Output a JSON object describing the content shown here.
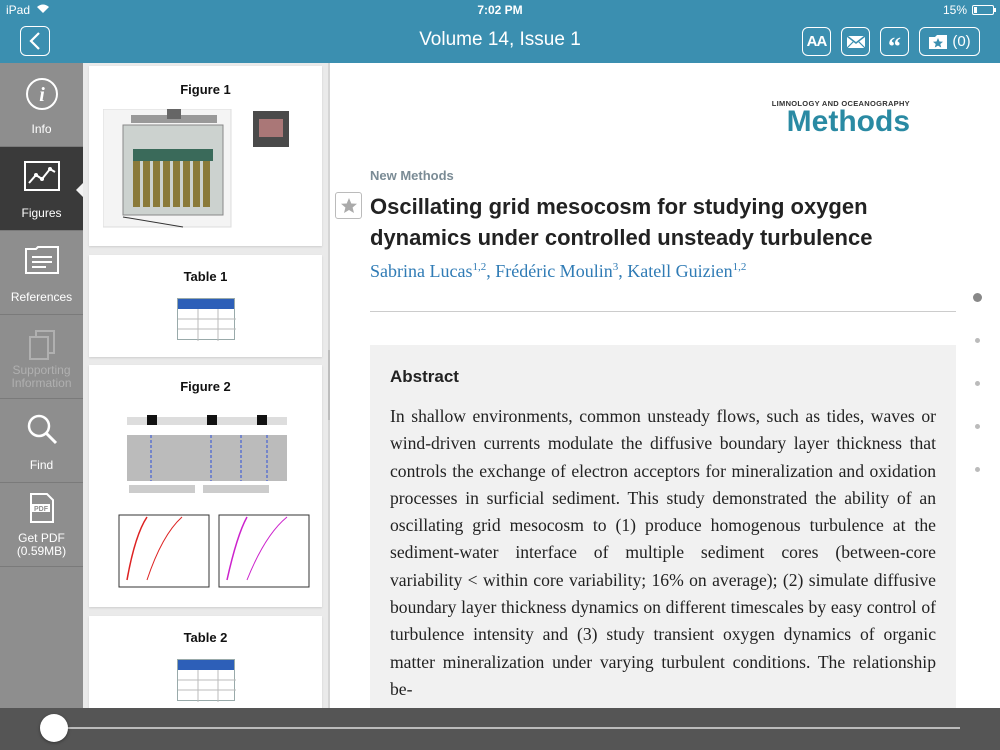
{
  "status": {
    "device": "iPad",
    "time": "7:02 PM",
    "battery": "15%",
    "battery_level": 0.15
  },
  "nav": {
    "title": "Volume 14, Issue 1",
    "text_size": "AA",
    "quote": "“",
    "saved_count": "(0)"
  },
  "sidebar": {
    "items": [
      {
        "label": "Info"
      },
      {
        "label": "Figures"
      },
      {
        "label": "References"
      },
      {
        "label": "Supporting Information"
      },
      {
        "label": "Find"
      },
      {
        "label": "Get PDF (0.59MB)",
        "pdf_badge": "PDF"
      }
    ]
  },
  "thumbnails": [
    {
      "label": "Figure 1"
    },
    {
      "label": "Table 1"
    },
    {
      "label": "Figure 2"
    },
    {
      "label": "Table 2"
    }
  ],
  "article": {
    "journal_small": "LIMNOLOGY AND OCEANOGRAPHY",
    "journal_big": "Methods",
    "section": "New Methods",
    "title": "Oscillating grid mesocosm for studying oxygen dynamics under controlled unsteady turbulence",
    "authors": [
      {
        "name": "Sabrina Lucas",
        "aff": "1,2"
      },
      {
        "name": "Frédéric Moulin",
        "aff": "3"
      },
      {
        "name": "Katell Guizien",
        "aff": "1,2"
      }
    ],
    "abstract_heading": "Abstract",
    "abstract_text": "In shallow environments, common unsteady flows, such as tides, waves or wind-driven currents modulate the diffusive boundary layer thickness that controls the exchange of electron acceptors for mineralization and oxidation processes in surficial sediment. This study demonstrated the ability of an oscillating grid mesocosm to (1) produce homogenous turbulence at the sediment-water interface of multiple sediment cores (between-core variability < within core variability; 16% on average); (2) simulate diffusive boundary layer thickness dynamics on different timescales by easy control of turbulence intensity and (3) study transient oxygen dynamics of organic matter mineralization under varying turbulent conditions. The relationship be-"
  },
  "colors": {
    "accent": "#3b8fb0",
    "journal": "#2a8aa3",
    "author_link": "#2f7bb5"
  }
}
